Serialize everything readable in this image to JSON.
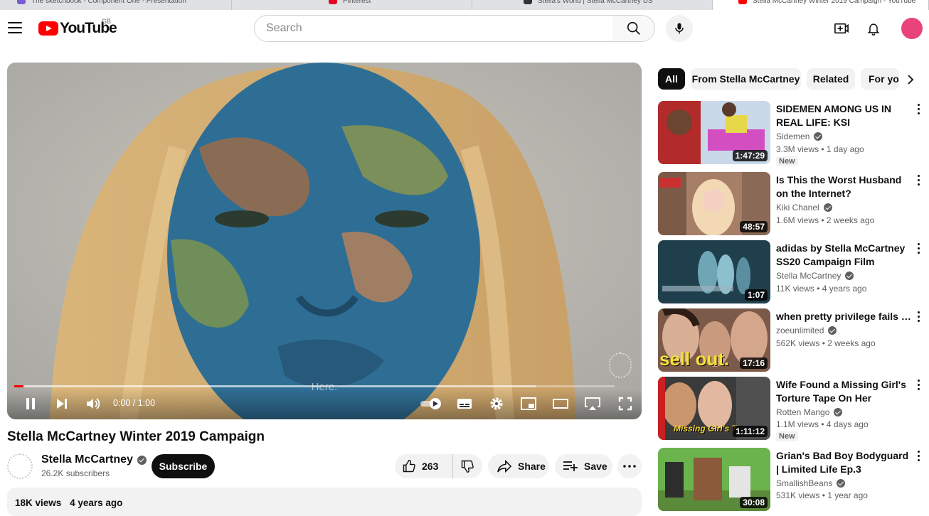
{
  "browser": {
    "tabs": [
      {
        "label": "The sketchbook - Component One - Presentation",
        "color": "#7b5cd6"
      },
      {
        "label": "Pinterest",
        "color": "#e60023"
      },
      {
        "label": "Stella's World | Stella McCartney US",
        "color": "#333333"
      },
      {
        "label": "Stella McCartney Winter 2019 Campaign - YouTube",
        "color": "#ff0000"
      }
    ]
  },
  "header": {
    "logo_text": "YouTube",
    "country_code": "GB",
    "search_placeholder": "Search",
    "icons": [
      "menu-icon",
      "search-icon",
      "mic-icon",
      "create-icon",
      "notifications-icon"
    ]
  },
  "player": {
    "caption": "Here.",
    "time": "0:00 / 1:00",
    "progress": 0.015,
    "buffered": 0.87
  },
  "video": {
    "title": "Stella McCartney Winter 2019 Campaign",
    "channel": "Stella McCartney",
    "subscribers": "26.2K subscribers",
    "subscribe_label": "Subscribe",
    "likes": "263",
    "share_label": "Share",
    "save_label": "Save",
    "views": "18K views",
    "age": "4 years ago"
  },
  "chips": [
    "All",
    "From Stella McCartney",
    "Related",
    "For you"
  ],
  "recommendations": [
    {
      "title": "SIDEMEN AMONG US IN REAL LIFE: KSI MASTERCLASS",
      "channel": "Sidemen",
      "views": "3.3M views",
      "age": "1 day ago",
      "duration": "1:47:29",
      "badge": "New"
    },
    {
      "title": "Is This the Worst Husband on the Internet?",
      "channel": "Kiki Chanel",
      "views": "1.6M views",
      "age": "2 weeks ago",
      "duration": "48:57",
      "badge": ""
    },
    {
      "title": "adidas by Stella McCartney SS20 Campaign Film",
      "channel": "Stella McCartney",
      "views": "11K views",
      "age": "4 years ago",
      "duration": "1:07",
      "badge": ""
    },
    {
      "title": "when pretty privilege fails you",
      "channel": "zoeunlimited",
      "views": "562K views",
      "age": "2 weeks ago",
      "duration": "17:16",
      "badge": "",
      "overlay_text": "sell out."
    },
    {
      "title": "Wife Found a Missing Girl's Torture Tape On Her Husband'…",
      "channel": "Rotten Mango",
      "views": "1.1M views",
      "age": "4 days ago",
      "duration": "1:11:12",
      "badge": "New",
      "overlay_text": "Missing Girl's T"
    },
    {
      "title": "Grian's Bad Boy Bodyguard | Limited Life Ep.3",
      "channel": "SmallishBeans",
      "views": "531K views",
      "age": "1 year ago",
      "duration": "30:08",
      "badge": ""
    }
  ]
}
